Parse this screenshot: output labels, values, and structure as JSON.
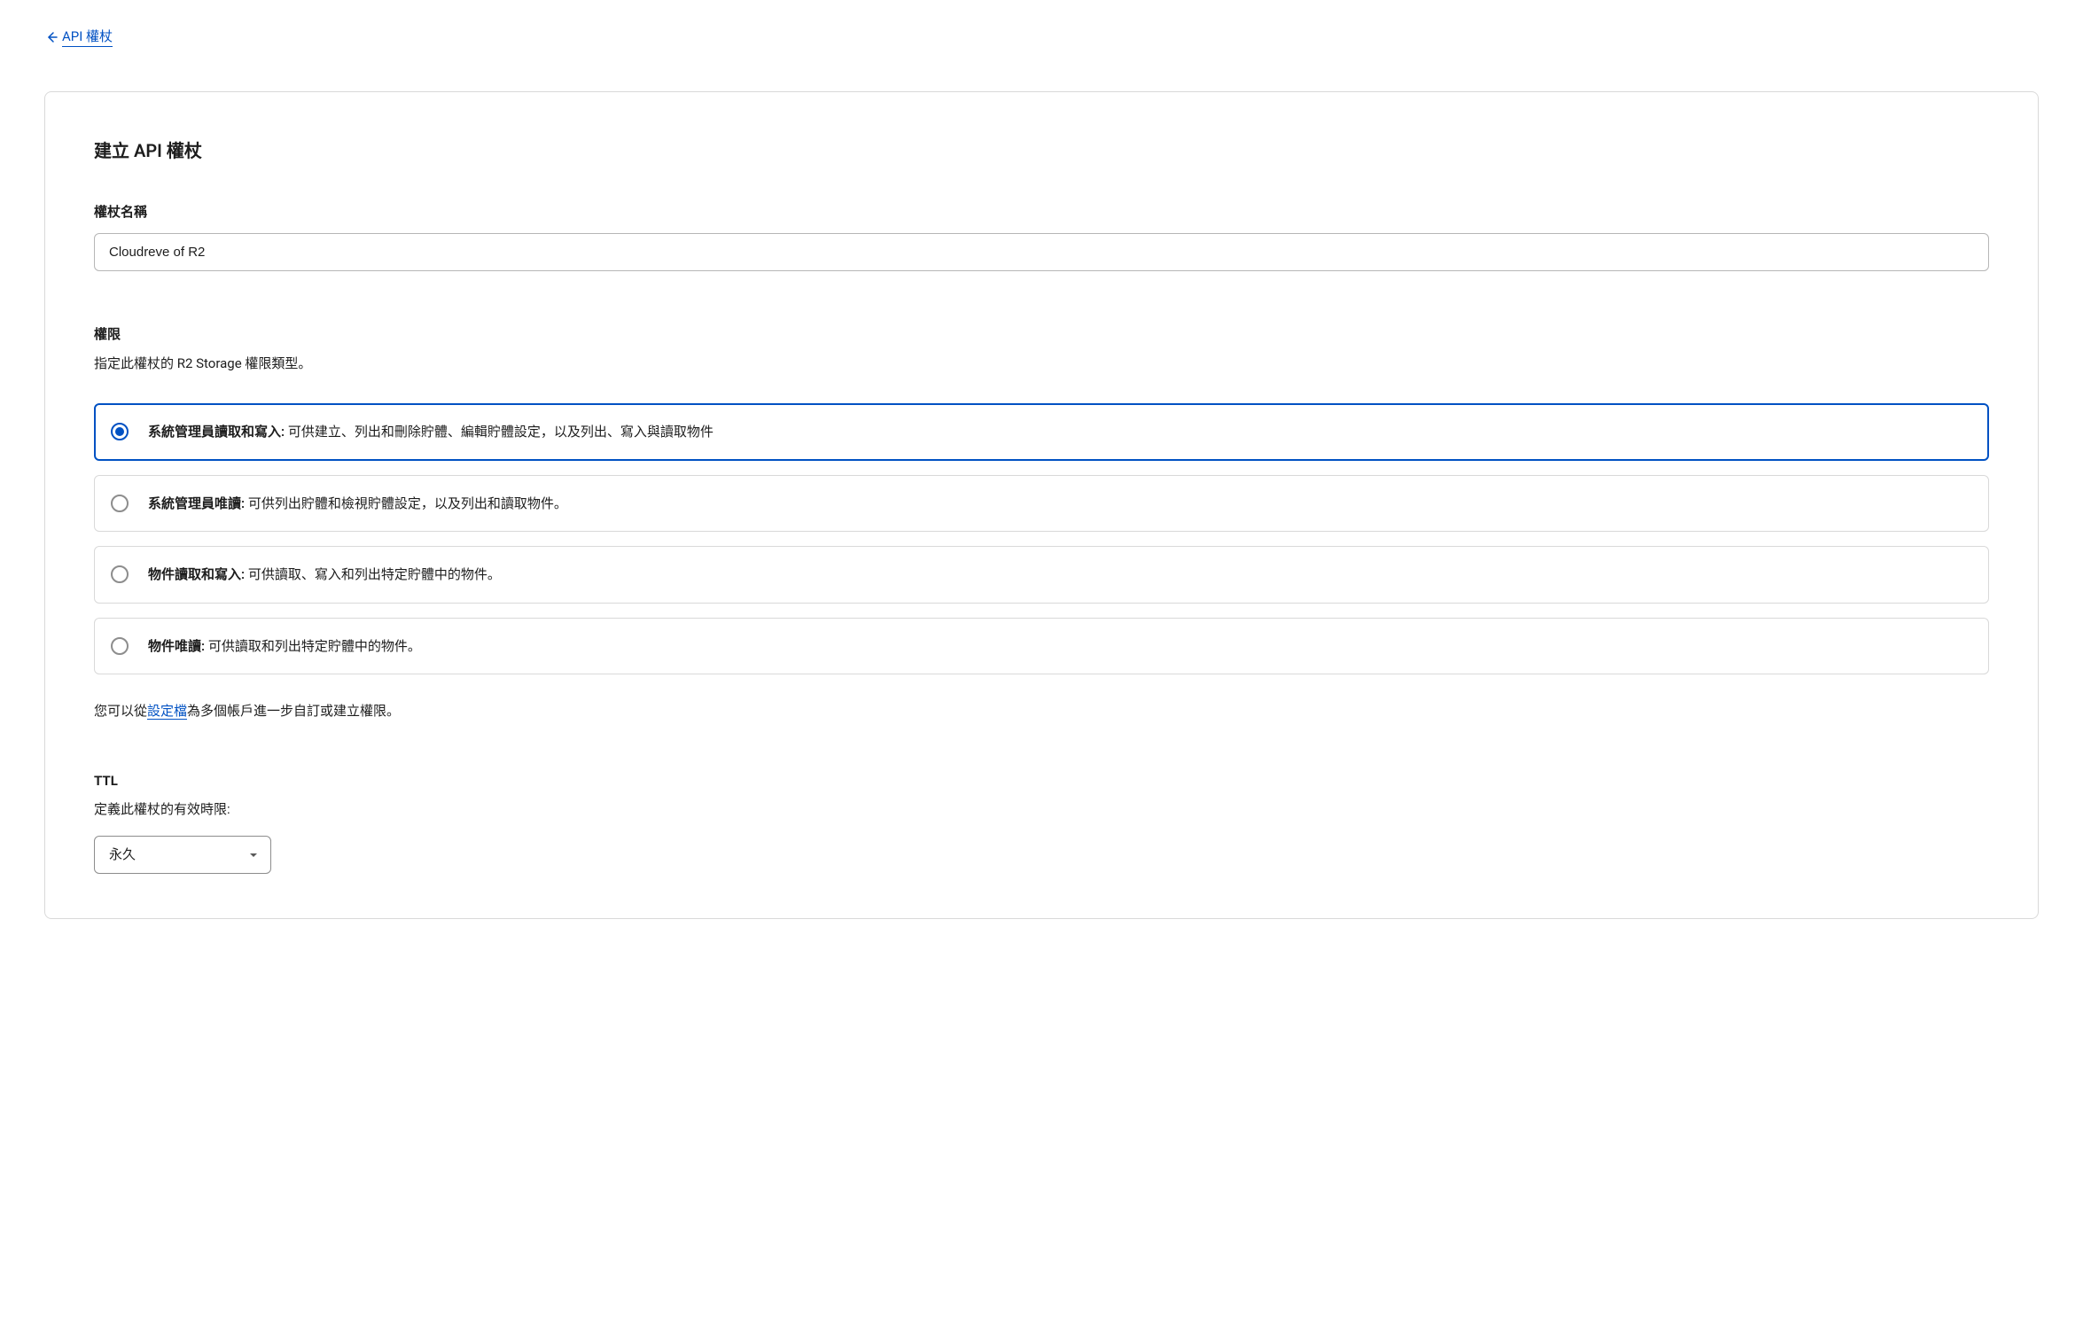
{
  "navigation": {
    "back_label": "API 權杖"
  },
  "page": {
    "title": "建立 API 權杖"
  },
  "token_name": {
    "label": "權杖名稱",
    "value": "Cloudreve of R2"
  },
  "permissions": {
    "title": "權限",
    "description": "指定此權杖的 R2 Storage 權限類型。",
    "options": [
      {
        "title": "系統管理員讀取和寫入:",
        "description": " 可供建立、列出和刪除貯體、編輯貯體設定，以及列出、寫入與讀取物件",
        "selected": true
      },
      {
        "title": "系統管理員唯讀:",
        "description": " 可供列出貯體和檢視貯體設定，以及列出和讀取物件。",
        "selected": false
      },
      {
        "title": "物件讀取和寫入:",
        "description": " 可供讀取、寫入和列出特定貯體中的物件。",
        "selected": false
      },
      {
        "title": "物件唯讀:",
        "description": " 可供讀取和列出特定貯體中的物件。",
        "selected": false
      }
    ],
    "helper_prefix": "您可以從",
    "helper_link": "設定檔",
    "helper_suffix": "為多個帳戶進一步自訂或建立權限。"
  },
  "ttl": {
    "label": "TTL",
    "description": "定義此權杖的有效時限:",
    "selected": "永久"
  }
}
